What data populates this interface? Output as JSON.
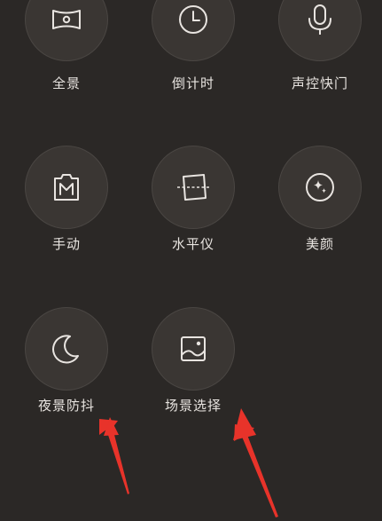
{
  "modes": [
    {
      "label": "全景",
      "icon": "panorama-icon"
    },
    {
      "label": "倒计时",
      "icon": "timer-icon"
    },
    {
      "label": "声控快门",
      "icon": "microphone-icon"
    },
    {
      "label": "手动",
      "icon": "manual-icon"
    },
    {
      "label": "水平仪",
      "icon": "level-icon"
    },
    {
      "label": "美颜",
      "icon": "beauty-icon"
    },
    {
      "label": "夜景防抖",
      "icon": "moon-icon"
    },
    {
      "label": "场景选择",
      "icon": "scene-icon"
    }
  ],
  "colors": {
    "background": "#2b2826",
    "circle": "#3a3633",
    "icon": "#e8e4e0",
    "annotation_arrow": "#e8332a"
  }
}
